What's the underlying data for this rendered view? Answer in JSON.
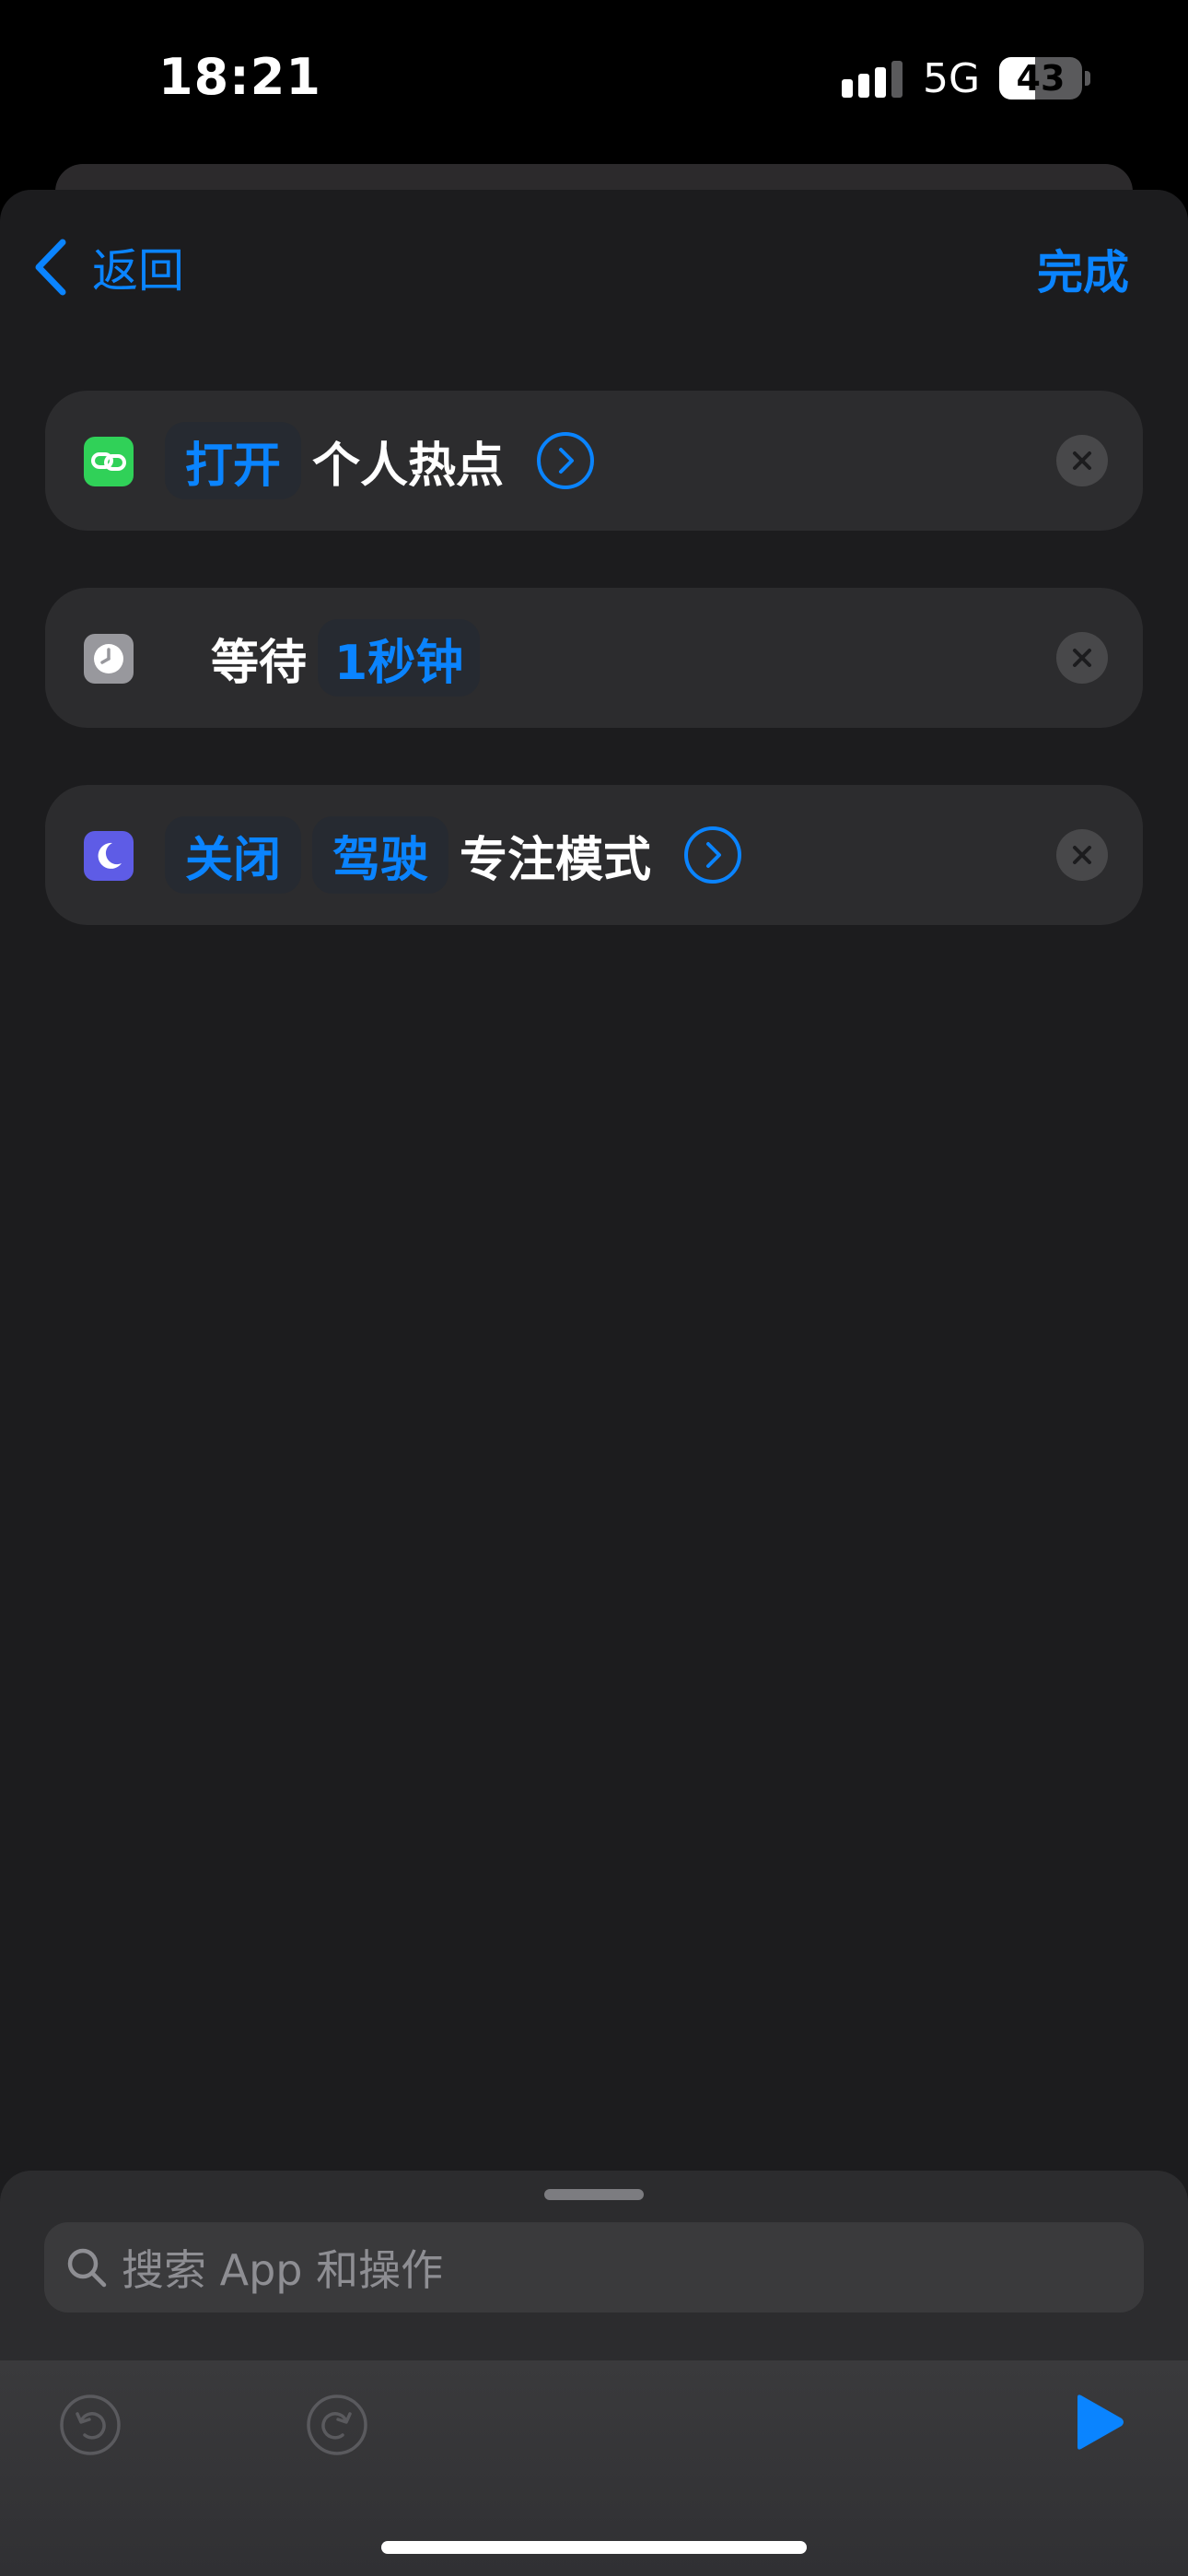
{
  "status_bar": {
    "time": "18:21",
    "network": "5G",
    "battery": "43",
    "battery_level": 0.43
  },
  "nav": {
    "back_label": "返回",
    "done_label": "完成"
  },
  "actions": [
    {
      "icon": "hotspot-link-icon",
      "icon_color": "#30d158",
      "token": "打开",
      "text": "个人热点"
    },
    {
      "icon": "clock-icon",
      "icon_color": "#98989d",
      "text": "等待",
      "token": "1秒钟"
    },
    {
      "icon": "moon-icon",
      "icon_color": "#5e5ce6",
      "token1": "关闭",
      "token2": "驾驶",
      "text": "专注模式"
    }
  ],
  "search": {
    "placeholder": "搜索 App 和操作"
  },
  "colors": {
    "accent": "#0a84ff",
    "background": "#1c1c1e",
    "card": "#2c2c2e"
  }
}
